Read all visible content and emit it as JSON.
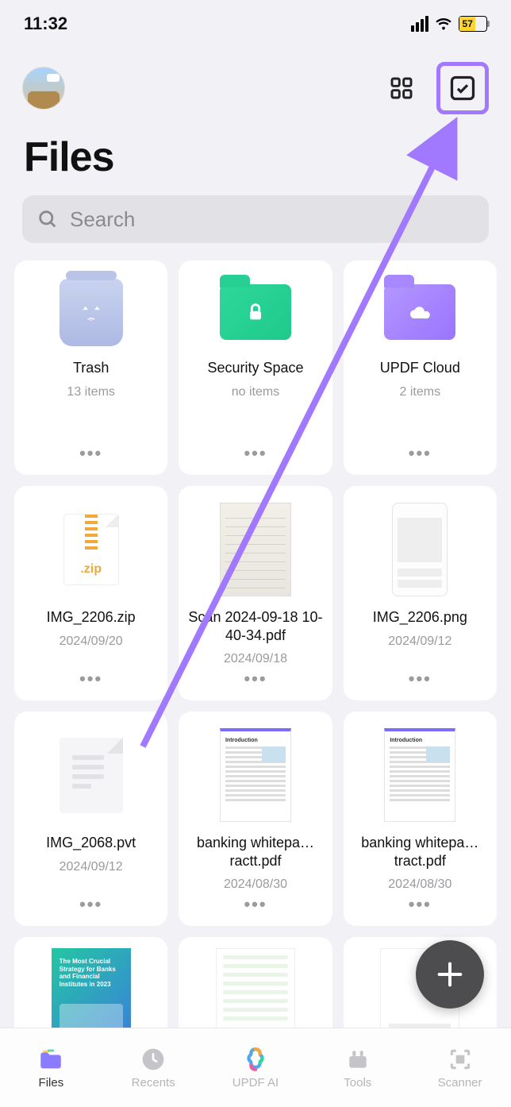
{
  "status": {
    "time": "11:32",
    "battery_pct": "57"
  },
  "header": {
    "title": "Files",
    "search_placeholder": "Search"
  },
  "tiles": [
    {
      "name": "Trash",
      "sub": "13 items"
    },
    {
      "name": "Security Space",
      "sub": "no items"
    },
    {
      "name": "UPDF Cloud",
      "sub": "2 items"
    },
    {
      "name": "IMG_2206.zip",
      "sub": "2024/09/20"
    },
    {
      "name": "Scan 2024-09-18 10-40-34.pdf",
      "sub": "2024/09/18"
    },
    {
      "name": "IMG_2206.png",
      "sub": "2024/09/12"
    },
    {
      "name": "IMG_2068.pvt",
      "sub": "2024/09/12"
    },
    {
      "name": "banking whitepa…ractt.pdf",
      "sub": "2024/08/30"
    },
    {
      "name": "banking whitepa…tract.pdf",
      "sub": "2024/08/30"
    }
  ],
  "zip_ext": ".zip",
  "pdf_heading": "Introduction",
  "cover_title": "The Most Crucial Strategy for Banks and Financial Institutes in 2023",
  "tabs": [
    {
      "label": "Files"
    },
    {
      "label": "Recents"
    },
    {
      "label": "UPDF AI"
    },
    {
      "label": "Tools"
    },
    {
      "label": "Scanner"
    }
  ],
  "more_glyph": "•••"
}
